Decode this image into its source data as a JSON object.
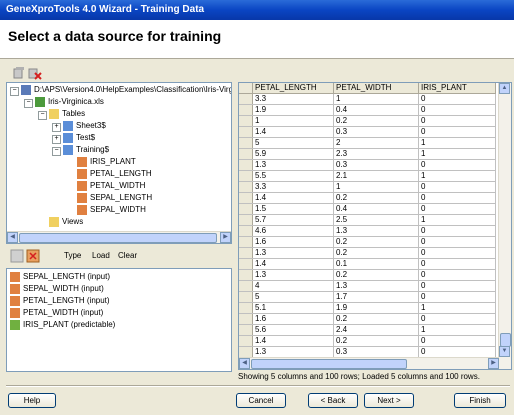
{
  "window": {
    "title": "GeneXproTools 4.0 Wizard - Training Data"
  },
  "header": {
    "title": "Select a data source for training"
  },
  "tree": {
    "root": "D:\\APS\\Version4.0\\HelpExamples\\Classification\\Iris-Virgin",
    "file": "Iris-Virginica.xls",
    "tables": "Tables",
    "sheet3": "Sheet3$",
    "test": "Test$",
    "training": "Training$",
    "fields": [
      "IRIS_PLANT",
      "PETAL_LENGTH",
      "PETAL_WIDTH",
      "SEPAL_LENGTH",
      "SEPAL_WIDTH"
    ],
    "views": "Views"
  },
  "midbar": {
    "type": "Type",
    "load": "Load",
    "clear": "Clear"
  },
  "variables": [
    "SEPAL_LENGTH (input)",
    "SEPAL_WIDTH (input)",
    "PETAL_LENGTH (input)",
    "PETAL_WIDTH (input)",
    "IRIS_PLANT (predictable)"
  ],
  "grid": {
    "columns": [
      "PETAL_LENGTH",
      "PETAL_WIDTH",
      "IRIS_PLANT"
    ],
    "rows": [
      [
        "3.3",
        "1",
        "0"
      ],
      [
        "1.9",
        "0.4",
        "0"
      ],
      [
        "1",
        "0.2",
        "0"
      ],
      [
        "1.4",
        "0.3",
        "0"
      ],
      [
        "5",
        "2",
        "1"
      ],
      [
        "5.9",
        "2.3",
        "1"
      ],
      [
        "1.3",
        "0.3",
        "0"
      ],
      [
        "5.5",
        "2.1",
        "1"
      ],
      [
        "3.3",
        "1",
        "0"
      ],
      [
        "1.4",
        "0.2",
        "0"
      ],
      [
        "1.5",
        "0.4",
        "0"
      ],
      [
        "5.7",
        "2.5",
        "1"
      ],
      [
        "4.6",
        "1.3",
        "0"
      ],
      [
        "1.6",
        "0.2",
        "0"
      ],
      [
        "1.3",
        "0.2",
        "0"
      ],
      [
        "1.4",
        "0.1",
        "0"
      ],
      [
        "1.3",
        "0.2",
        "0"
      ],
      [
        "4",
        "1.3",
        "0"
      ],
      [
        "5",
        "1.7",
        "0"
      ],
      [
        "5.1",
        "1.9",
        "1"
      ],
      [
        "1.6",
        "0.2",
        "0"
      ],
      [
        "5.6",
        "2.4",
        "1"
      ],
      [
        "1.4",
        "0.2",
        "0"
      ],
      [
        "1.3",
        "0.3",
        "0"
      ]
    ]
  },
  "status": "Showing 5 columns and 100 rows; Loaded 5 columns and 100 rows.",
  "buttons": {
    "help": "Help",
    "cancel": "Cancel",
    "back": "< Back",
    "next": "Next >",
    "finish": "Finish"
  }
}
